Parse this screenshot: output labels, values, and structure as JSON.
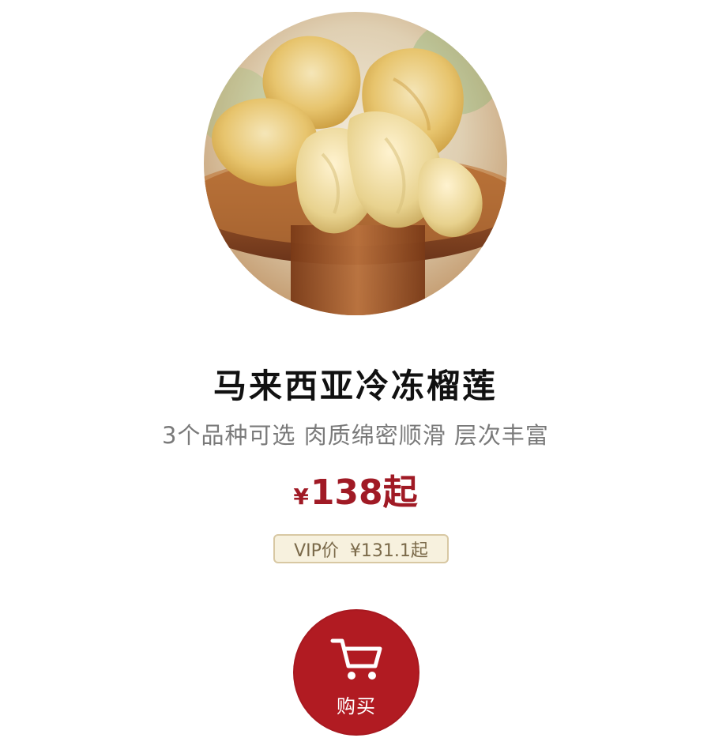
{
  "product": {
    "title": "马来西亚冷冻榴莲",
    "subtitle": "3个品种可选 肉质绵密顺滑 层次丰富",
    "image_alt": "product-photo"
  },
  "price": {
    "currency": "¥",
    "amount": "138",
    "suffix": "起"
  },
  "vip": {
    "label": "VIP价",
    "price": "¥131.1起"
  },
  "actions": {
    "buy_label": "购买",
    "buy_icon": "shopping-cart-icon"
  },
  "colors": {
    "accent_red": "#a01a25",
    "button_red": "#b11b22",
    "vip_bg": "#f7f1de",
    "vip_border": "#d8c8a3",
    "vip_text": "#7b6a4a",
    "subtitle_gray": "#7a7a7a"
  }
}
